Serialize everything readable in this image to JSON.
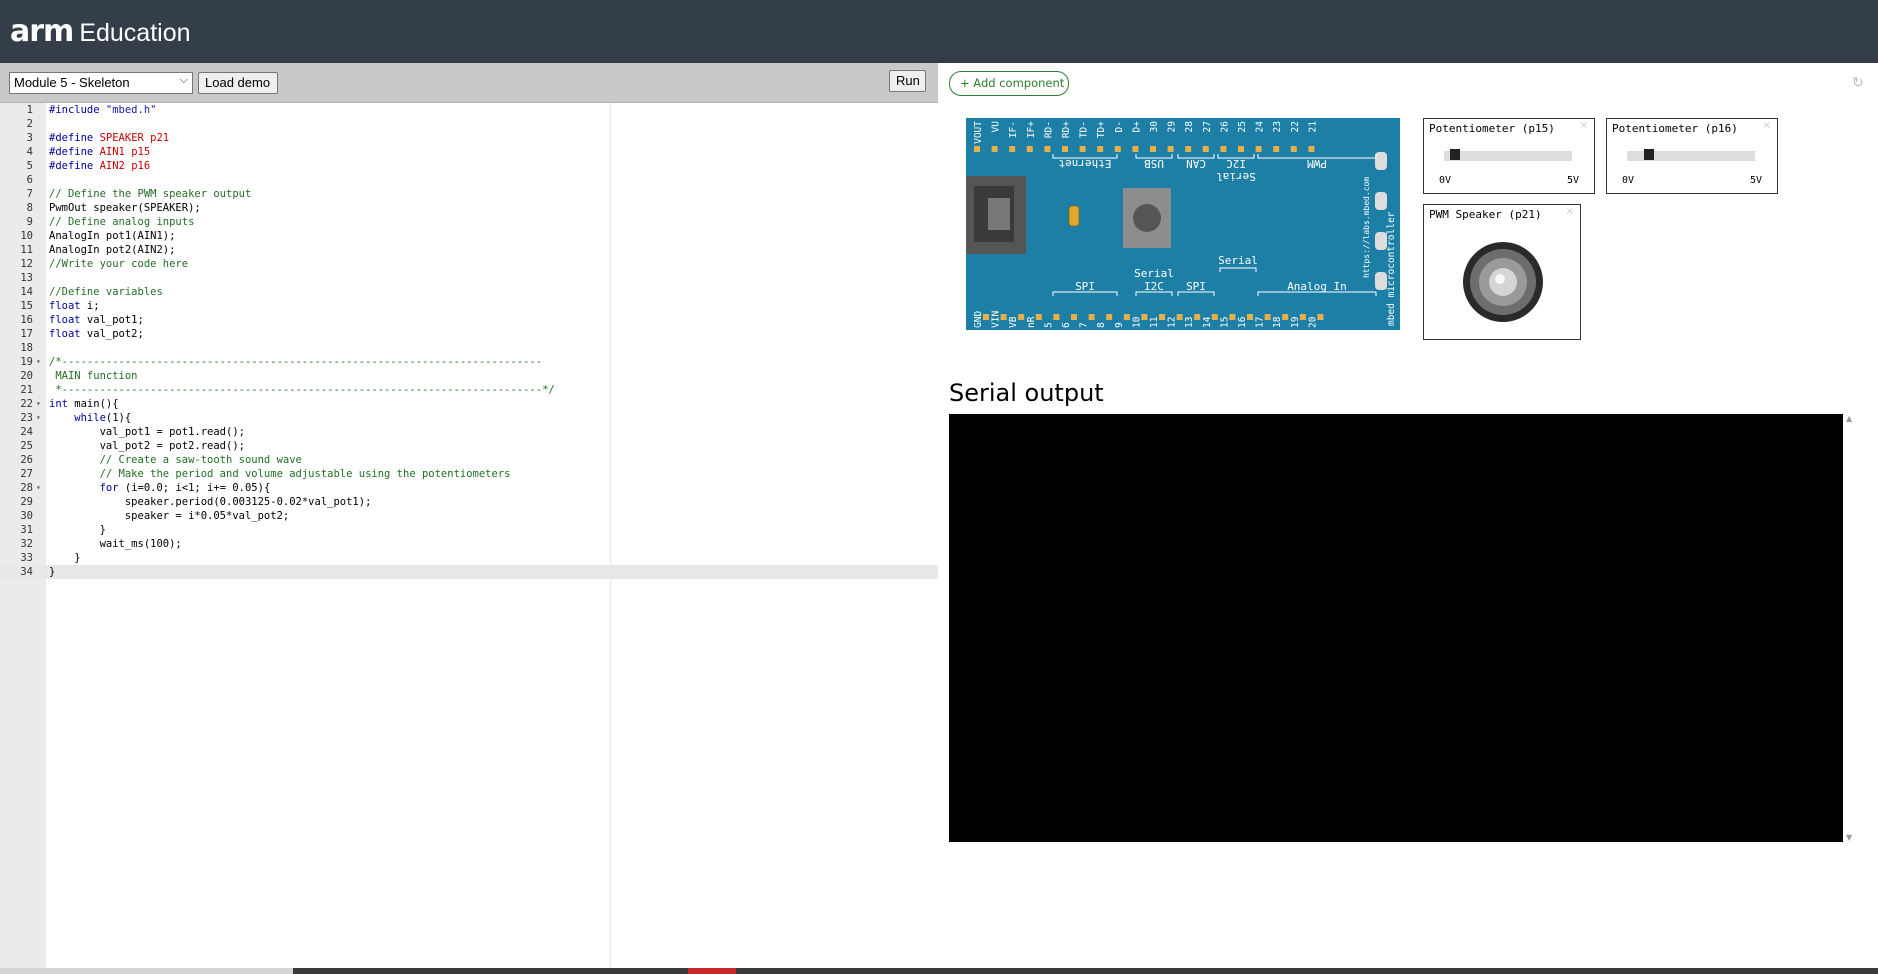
{
  "header": {
    "brand_arm": "arm",
    "brand_edu": "Education",
    "bg_color": "#333e48"
  },
  "toolbar": {
    "module_select": "Module 5 - Skeleton",
    "load_demo_label": "Load demo",
    "run_label": "Run"
  },
  "editor": {
    "lines": [
      {
        "n": "1",
        "fold": ""
      },
      {
        "n": "2",
        "fold": ""
      },
      {
        "n": "3",
        "fold": ""
      },
      {
        "n": "4",
        "fold": ""
      },
      {
        "n": "5",
        "fold": ""
      },
      {
        "n": "6",
        "fold": ""
      },
      {
        "n": "7",
        "fold": ""
      },
      {
        "n": "8",
        "fold": ""
      },
      {
        "n": "9",
        "fold": ""
      },
      {
        "n": "10",
        "fold": ""
      },
      {
        "n": "11",
        "fold": ""
      },
      {
        "n": "12",
        "fold": ""
      },
      {
        "n": "13",
        "fold": ""
      },
      {
        "n": "14",
        "fold": ""
      },
      {
        "n": "15",
        "fold": ""
      },
      {
        "n": "16",
        "fold": ""
      },
      {
        "n": "17",
        "fold": ""
      },
      {
        "n": "18",
        "fold": ""
      },
      {
        "n": "19",
        "fold": "▾"
      },
      {
        "n": "20",
        "fold": ""
      },
      {
        "n": "21",
        "fold": ""
      },
      {
        "n": "22",
        "fold": "▾"
      },
      {
        "n": "23",
        "fold": "▾"
      },
      {
        "n": "24",
        "fold": ""
      },
      {
        "n": "25",
        "fold": ""
      },
      {
        "n": "26",
        "fold": ""
      },
      {
        "n": "27",
        "fold": ""
      },
      {
        "n": "28",
        "fold": "▾"
      },
      {
        "n": "29",
        "fold": ""
      },
      {
        "n": "30",
        "fold": ""
      },
      {
        "n": "31",
        "fold": ""
      },
      {
        "n": "32",
        "fold": ""
      },
      {
        "n": "33",
        "fold": ""
      },
      {
        "n": "34",
        "fold": ""
      }
    ],
    "code": {
      "l1_kw": "#include",
      "l1_str": " \"mbed.h\"",
      "l3_kw": "#define",
      "l3_rest": " SPEAKER p21",
      "l4_kw": "#define",
      "l4_rest": " AIN1 p15",
      "l5_kw": "#define",
      "l5_rest": " AIN2 p16",
      "l7": "// Define the PWM speaker output",
      "l8": "PwmOut speaker(SPEAKER);",
      "l9": "// Define analog inputs",
      "l10": "AnalogIn pot1(AIN1);",
      "l11": "AnalogIn pot2(AIN2);",
      "l12": "//Write your code here",
      "l14": "//Define variables",
      "l15_kw": "float",
      "l15_rest": " i;",
      "l16_kw": "float",
      "l16_rest": " val_pot1;",
      "l17_kw": "float",
      "l17_rest": " val_pot2;",
      "l19": "/*----------------------------------------------------------------------------",
      "l20": " MAIN function",
      "l21": " *----------------------------------------------------------------------------*/",
      "l22_kw": "int",
      "l22_rest": " main(){",
      "l23_kw": "    while",
      "l23_rest": "(1){",
      "l24": "        val_pot1 = pot1.read();",
      "l25": "        val_pot2 = pot2.read();",
      "l26": "        // Create a saw-tooth sound wave",
      "l27": "        // Make the period and volume adjustable using the potentiometers",
      "l28_kw": "        for",
      "l28_rest": " (i=0.0; i<1; i+= 0.05){",
      "l29": "            speaker.period(0.003125-0.02*val_pot1);",
      "l30": "            speaker = i*0.05*val_pot2;",
      "l31": "        }",
      "l32": "        wait_ms(100);",
      "l33": "    }",
      "l34": "}"
    }
  },
  "right": {
    "add_component_label": "+ Add component",
    "refresh_icon": "↻",
    "board": {
      "top_pins": [
        "VOUT",
        "VU",
        "IF-",
        "IF+",
        "RD-",
        "RD+",
        "TD-",
        "TD+",
        "D-",
        "D+",
        "30",
        "29",
        "28",
        "27",
        "26",
        "25",
        "24",
        "23",
        "22",
        "21"
      ],
      "bottom_pins": [
        "GND",
        "VIN",
        "VB",
        "nR",
        "5",
        "6",
        "7",
        "8",
        "9",
        "10",
        "11",
        "12",
        "13",
        "14",
        "15",
        "16",
        "17",
        "18",
        "19",
        "20"
      ],
      "top_groups": [
        "Ethernet",
        "USB",
        "CAN",
        "I2C",
        "PWM"
      ],
      "top_serial": "Serial",
      "bottom_groups": [
        "SPI",
        "I2C",
        "SPI",
        "Analog In"
      ],
      "bottom_serial1": "Serial",
      "bottom_serial2": "Serial",
      "side_text": "mbed microcontroller",
      "url_text": "https://labs.mbed.com"
    },
    "components": {
      "pot1_title": "Potentiometer (p15)",
      "pot1_level": 0.05,
      "pot2_title": "Potentiometer (p16)",
      "pot2_level": 0.14,
      "min_label": "0V",
      "max_label": "5V",
      "speaker_title": "PWM Speaker (p21)",
      "close_glyph": "×"
    },
    "serial_title": "Serial output",
    "serial_text": ""
  }
}
